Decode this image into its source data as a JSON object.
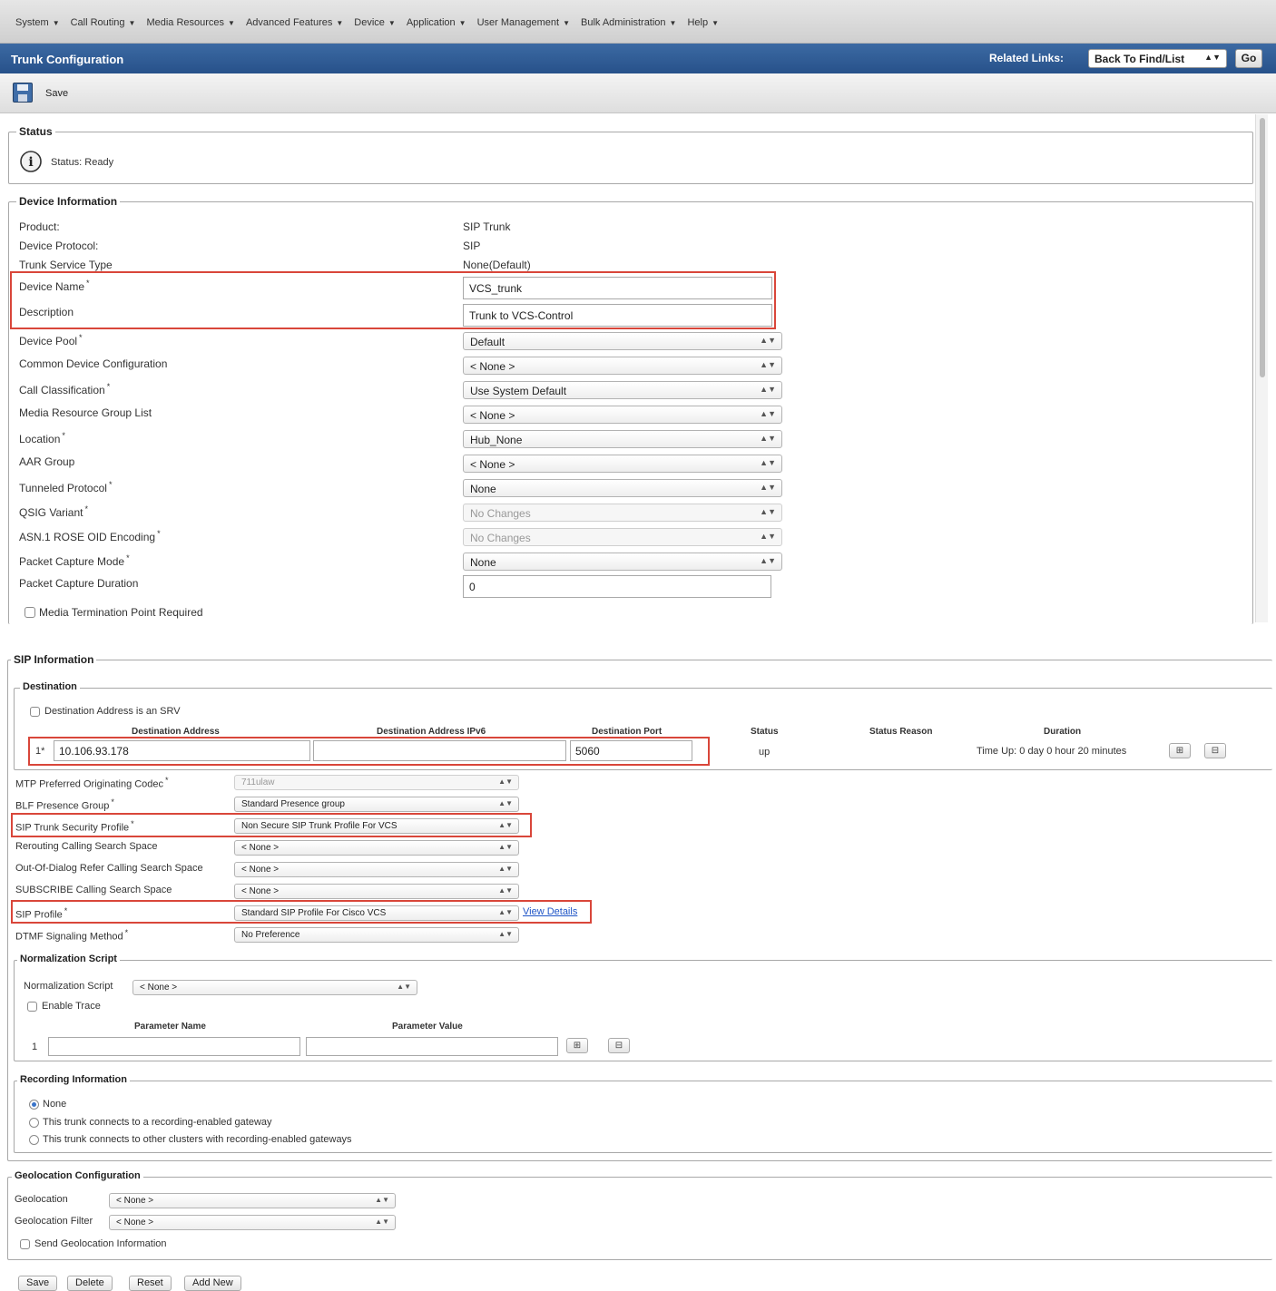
{
  "menu": {
    "items": [
      "System",
      "Call Routing",
      "Media Resources",
      "Advanced Features",
      "Device",
      "Application",
      "User Management",
      "Bulk Administration",
      "Help"
    ]
  },
  "titlebar": {
    "title": "Trunk Configuration",
    "related_links_label": "Related Links:",
    "related_links_value": "Back To Find/List",
    "go_label": "Go"
  },
  "toolbar": {
    "save_label": "Save"
  },
  "status": {
    "legend": "Status",
    "text": "Status: Ready"
  },
  "device_info": {
    "legend": "Device Information",
    "product_label": "Product:",
    "product_value": "SIP Trunk",
    "protocol_label": "Device Protocol:",
    "protocol_value": "SIP",
    "service_type_label": "Trunk Service Type",
    "service_type_value": "None(Default)",
    "device_name_label": "Device Name",
    "device_name_value": "VCS_trunk",
    "description_label": "Description",
    "description_value": "Trunk to VCS-Control",
    "device_pool_label": "Device Pool",
    "device_pool_value": "Default",
    "common_config_label": "Common Device Configuration",
    "common_config_value": "< None >",
    "call_class_label": "Call Classification",
    "call_class_value": "Use System Default",
    "mrgl_label": "Media Resource Group List",
    "mrgl_value": "< None >",
    "location_label": "Location",
    "location_value": "Hub_None",
    "aar_label": "AAR Group",
    "aar_value": "< None >",
    "tunneled_label": "Tunneled Protocol",
    "tunneled_value": "None",
    "qsig_label": "QSIG Variant",
    "qsig_value": "No Changes",
    "asn_label": "ASN.1 ROSE OID Encoding",
    "asn_value": "No Changes",
    "pcap_mode_label": "Packet Capture Mode",
    "pcap_mode_value": "None",
    "pcap_duration_label": "Packet Capture Duration",
    "pcap_duration_value": "0",
    "mtp_label": "Media Termination Point Required",
    "required_mark": "*"
  },
  "sip_info": {
    "legend": "SIP Information",
    "destination_legend": "Destination",
    "srv_label": "Destination Address is an SRV",
    "col_address": "Destination Address",
    "col_address_v6": "Destination Address IPv6",
    "col_port": "Destination Port",
    "col_status": "Status",
    "col_status_reason": "Status Reason",
    "col_duration": "Duration",
    "row_index": "1*",
    "address_value": "10.106.93.178",
    "address_v6_value": "",
    "port_value": "5060",
    "status_value": "up",
    "duration_value": "Time Up: 0 day 0 hour 20 minutes",
    "mtp_codec_label": "MTP Preferred Originating Codec",
    "mtp_codec_value": "711ulaw",
    "blf_label": "BLF Presence Group",
    "blf_value": "Standard Presence group",
    "security_label": "SIP Trunk Security Profile",
    "security_value": "Non Secure SIP Trunk Profile For VCS",
    "rerouting_label": "Rerouting Calling Search Space",
    "rerouting_value": "< None >",
    "ood_label": "Out-Of-Dialog Refer Calling Search Space",
    "ood_value": "< None >",
    "subscribe_label": "SUBSCRIBE Calling Search Space",
    "subscribe_value": "< None >",
    "sip_profile_label": "SIP Profile",
    "sip_profile_value": "Standard SIP Profile For Cisco VCS",
    "view_details": "View Details",
    "dtmf_label": "DTMF Signaling Method",
    "dtmf_value": "No Preference"
  },
  "normalization": {
    "legend": "Normalization Script",
    "script_label": "Normalization Script",
    "script_value": "< None >",
    "trace_label": "Enable Trace",
    "col_param_name": "Parameter Name",
    "col_param_value": "Parameter Value",
    "row_index": "1"
  },
  "recording": {
    "legend": "Recording Information",
    "options": [
      "None",
      "This trunk connects to a recording-enabled gateway",
      "This trunk connects to other clusters with recording-enabled gateways"
    ]
  },
  "geolocation": {
    "legend": "Geolocation Configuration",
    "geo_label": "Geolocation",
    "geo_value": "< None >",
    "filter_label": "Geolocation Filter",
    "filter_value": "< None >",
    "send_label": "Send Geolocation Information"
  },
  "bottom_buttons": {
    "save": "Save",
    "delete": "Delete",
    "reset": "Reset",
    "add_new": "Add New"
  }
}
